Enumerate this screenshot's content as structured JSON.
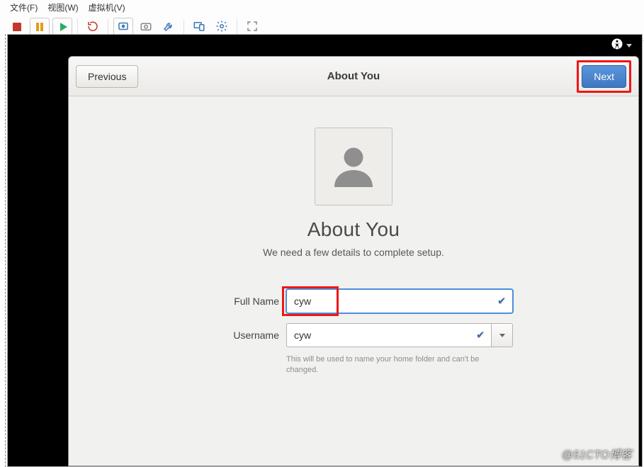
{
  "host": {
    "menu": {
      "file": "文件(F)",
      "view": "视图(W)",
      "vm": "虚拟机(V)"
    },
    "toolbar_icons": {
      "stop": "stop",
      "pause": "pause",
      "play": "play",
      "refresh": "refresh",
      "snapshot": "snapshot",
      "camera": "camera",
      "manage": "manage",
      "devices": "devices",
      "settings": "settings",
      "fullscreen": "fullscreen"
    }
  },
  "accessibility_menu_label": "Accessibility",
  "dialog": {
    "header_title": "About You",
    "previous": "Previous",
    "next": "Next",
    "heading": "About You",
    "subheading": "We need a few details to complete setup.",
    "fullname_label": "Full Name",
    "fullname_value": "cyw",
    "username_label": "Username",
    "username_value": "cyw",
    "username_hint": "This will be used to name your home folder and can't be changed."
  },
  "watermark": "@51CTO博客"
}
